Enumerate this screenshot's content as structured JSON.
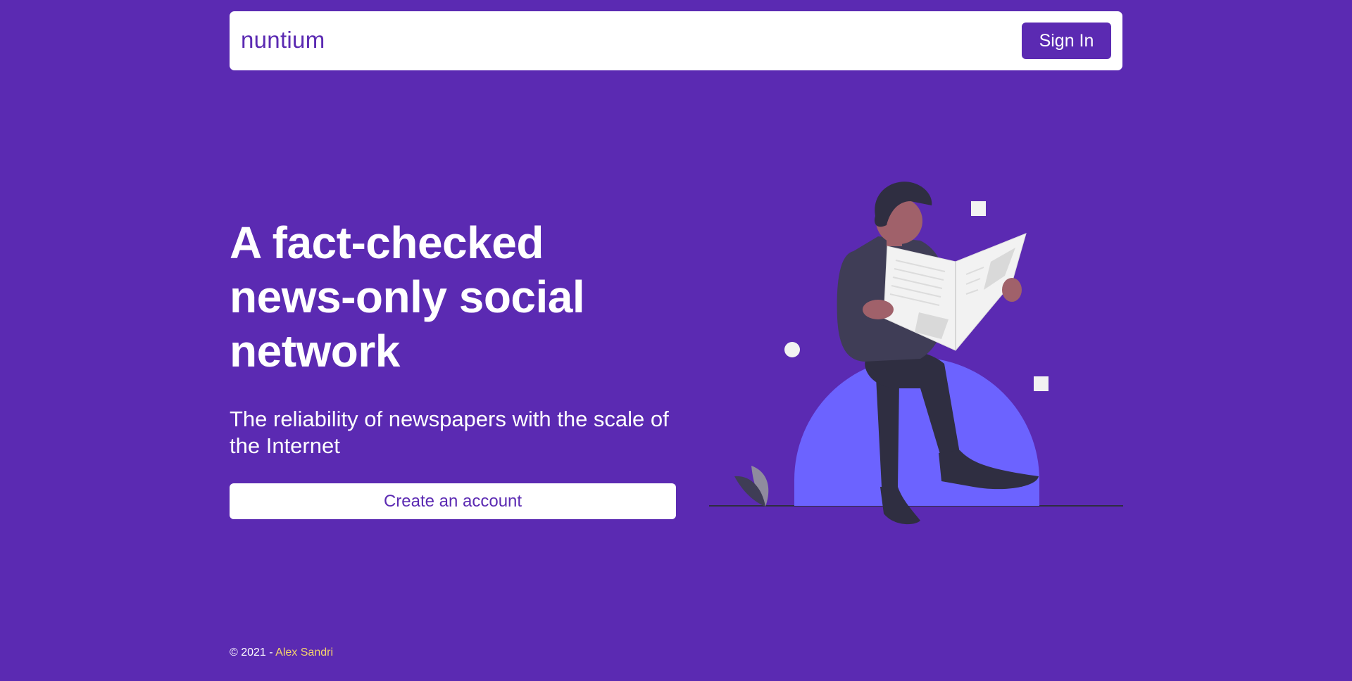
{
  "header": {
    "brand": "nuntium",
    "signin_label": "Sign In"
  },
  "hero": {
    "title": "A fact-checked news-only social network",
    "subtitle": "The reliability of newspapers with the scale of the Internet",
    "cta_label": "Create an account"
  },
  "illustration": {
    "icon": "man-reading-newspaper-illustration"
  },
  "footer": {
    "copyright": "© 2021 - ",
    "author": "Alex Sandri"
  },
  "colors": {
    "background": "#5b2ab2",
    "surface": "#ffffff",
    "accent_link": "#f5d36b",
    "illustration_dome": "#6c63ff"
  }
}
